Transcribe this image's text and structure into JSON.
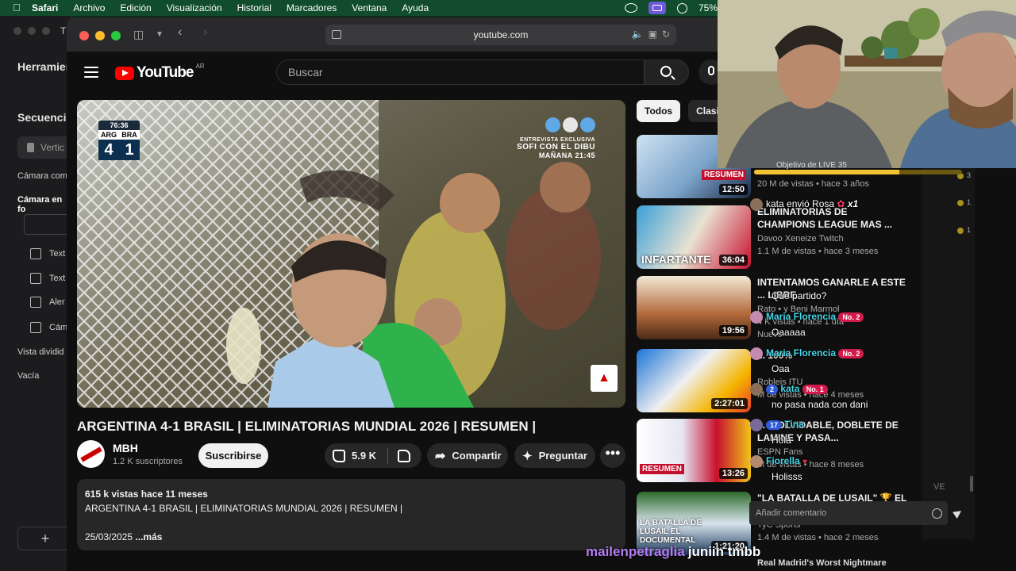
{
  "menubar": {
    "app": "Safari",
    "items": [
      "Archivo",
      "Edición",
      "Visualización",
      "Historial",
      "Marcadores",
      "Ventana",
      "Ayuda"
    ],
    "battery": "75%"
  },
  "bg_window": {
    "title_stub": "T",
    "header1": "Herramien",
    "header2": "Secuencia",
    "select_label": "Vertic",
    "camera1": "Cámara com",
    "camera2": "Cámara en fo",
    "rows": [
      "Text",
      "Text",
      "Aler",
      "Cám"
    ],
    "split_view": "Vista dividid",
    "empty": "Vacía",
    "plus": "+"
  },
  "safari": {
    "url": "youtube.com"
  },
  "youtube": {
    "logo_text": "YouTube",
    "country": "AR",
    "search_placeholder": "Buscar",
    "video": {
      "title": "ARGENTINA 4-1 BRASIL | ELIMINATORIAS MUNDIAL 2026 | RESUMEN |",
      "scoreboard": {
        "time": "76:36",
        "team1": "ARG",
        "team2": "BRA",
        "score1": "4",
        "score2": "1"
      },
      "promo": {
        "line1": "ENTREVISTA EXCLUSIVA",
        "line2": "SOFI CON EL DIBU",
        "line3": "MAÑANA 21:45"
      }
    },
    "channel": {
      "name": "MBH",
      "subscribers": "1.2 K suscriptores"
    },
    "subscribe_label": "Suscribirse",
    "likes": "5.9 K",
    "share_label": "Compartir",
    "ask_label": "Preguntar",
    "more_label": "•••",
    "description": {
      "meta": "615 k vistas  hace 11 meses",
      "text": "ARGENTINA 4-1 BRASIL | ELIMINATORIAS MUNDIAL 2026 | RESUMEN |",
      "date": "25/03/2025",
      "more": " ...más"
    },
    "chips": [
      "Todos",
      "Clasif"
    ],
    "recommendations": [
      {
        "title": "Objetivo de LIVE 35",
        "channel": "",
        "views": "20 M de vistas • hace 3 años",
        "duration": "12:50",
        "label": "RESUMEN"
      },
      {
        "title": "ELIMINATORIAS DE CHAMPIONS LEAGUE MAS ...",
        "channel": "Davoo Xeneize Twitch",
        "views": "1.1 M de vistas • hace 3 meses",
        "duration": "36:04",
        "label": "INFARTANTE"
      },
      {
        "title": "INTENTAMOS GANARLE A ESTE ... LIBRE",
        "channel": "Rato • y Beni Marmol",
        "views": "4 K vistas • hace 1 día",
        "duration": "19:56",
        "label": "Nuevo"
      },
      {
        "title": "... 100%",
        "channel": "Robleis ITU",
        "views": "M de vistas • hace 4 meses",
        "duration": "2:27:01",
        "label": ""
      },
      {
        "title": "... INOLVIDABLE, DOBLETE DE LAMINE Y PASA...",
        "channel": "ESPN Fans",
        "views": "M de vistas • hace 8 meses",
        "duration": "13:26",
        "label": "RESUMEN"
      },
      {
        "title": "\"LA BATALLA DE LUSAIL\" 🏆 EL DOCUMENTAL de ARGENTINA ...",
        "channel": "TyC Sports",
        "views": "1.4 M de vistas • hace 2 meses",
        "duration": "1:21:20",
        "label": "LA BATALLA DE LUSAIL EL DOCUMENTAL"
      }
    ],
    "next_title": "Real Madrid's Worst Nightmare"
  },
  "stream_overlay": {
    "goal": {
      "label": "Objetivo de LIVE 35",
      "progress": 0.7
    },
    "gift": {
      "user": "kata",
      "action": "envió Rosa",
      "count": "x1"
    },
    "chat": [
      {
        "user": "",
        "text": "Que partido?",
        "badge": ""
      },
      {
        "user": "Maria Florencia",
        "text": "Oaaaaa",
        "badge": "No. 2"
      },
      {
        "user": "Maria Florencia",
        "text": "Oaa",
        "badge": "No. 2"
      },
      {
        "user": "kata",
        "text": "no pasa nada con dani",
        "badge": "No. 1",
        "level": "2"
      },
      {
        "user": "Tina",
        "text": "Hola",
        "badge": "",
        "level": "17"
      },
      {
        "user": "Fiorella",
        "text": "Holisss",
        "badge": ""
      }
    ],
    "input_placeholder": "Añadir comentario",
    "coin_counts": [
      "3",
      "1",
      "1"
    ],
    "ve_stub": "VE",
    "names": {
      "a": "mailenpetraglia",
      "b": "juniin tmbb"
    }
  }
}
